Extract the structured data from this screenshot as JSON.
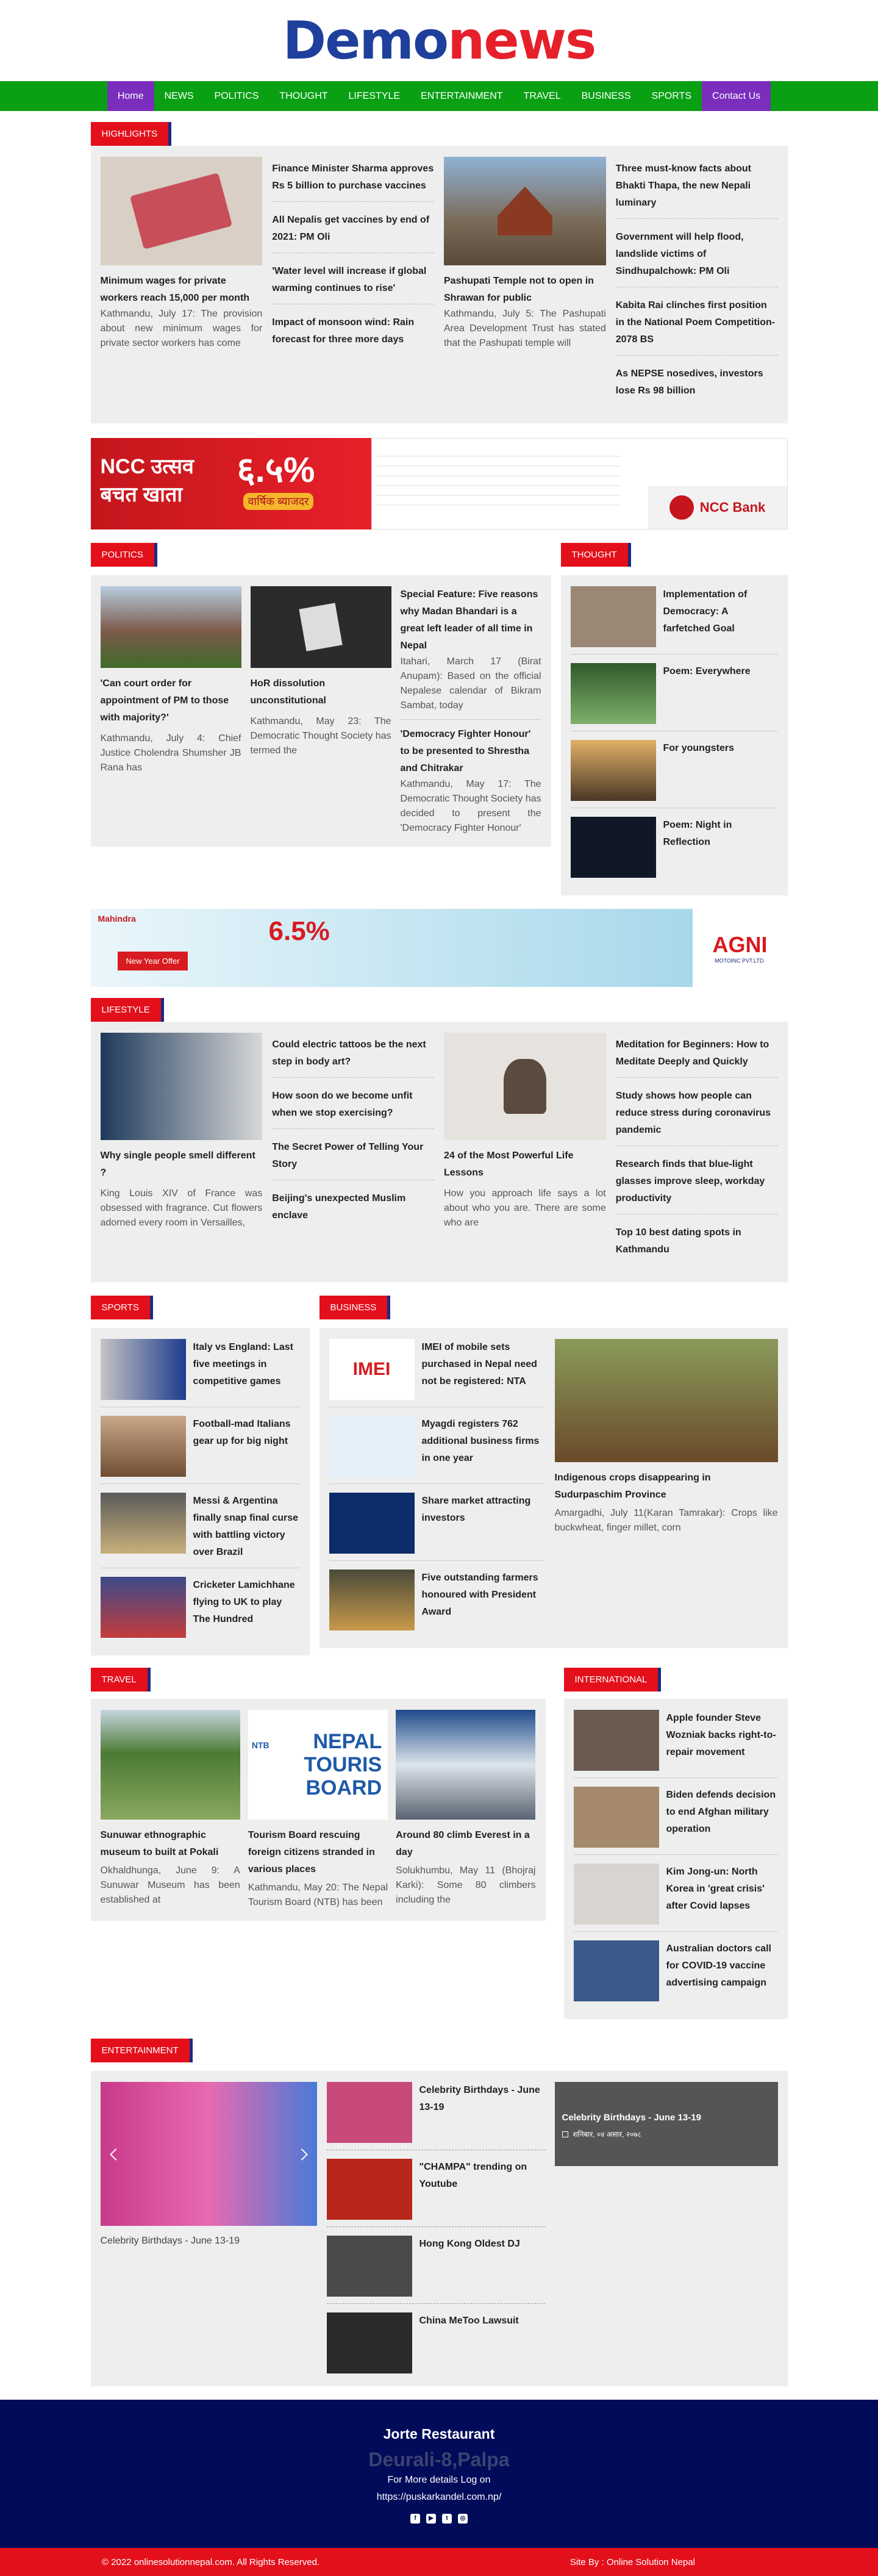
{
  "logo": {
    "a": "Demo",
    "b": "news"
  },
  "nav": [
    "Home",
    "NEWS",
    "POLITICS",
    "THOUGHT",
    "LIFESTYLE",
    "ENTERTAINMENT",
    "TRAVEL",
    "BUSINESS",
    "SPORTS",
    "Contact Us"
  ],
  "highlights": {
    "label": "HIGHLIGHTS",
    "main1": {
      "title": "Minimum wages for private workers reach 15,000 per month",
      "desc": "Kathmandu, July 17: The provision about new minimum wages for private sector workers has come"
    },
    "list1": [
      "Finance Minister Sharma approves Rs 5 billion to purchase vaccines",
      "All Nepalis get vaccines by end of 2021: PM Oli",
      "'Water level will increase if global warming continues to rise'",
      "Impact of monsoon wind: Rain forecast for three more days"
    ],
    "main2": {
      "title": "Pashupati Temple not to open in Shrawan for public",
      "desc": "Kathmandu, July 5: The Pashupati Area Development Trust has stated that the Pashupati temple will"
    },
    "list2": [
      "Three must-know facts about Bhakti Thapa, the new Nepali luminary",
      "Government will help flood, landslide victims of Sindhupalchowk: PM Oli",
      "Kabita Rai clinches first position in the National Poem Competition-2078 BS",
      "As NEPSE nosedives, investors lose Rs 98 billion"
    ]
  },
  "ad1": {
    "t1": "NCC उत्सव",
    "t2": "बचत खाता",
    "rate": "६.५%",
    "sub": "वार्षिक ब्याजदर",
    "bank": "NCC Bank"
  },
  "politics": {
    "label": "POLITICS",
    "a": {
      "title": "'Can court order for appointment of PM to those with majority?'",
      "desc": "Kathmandu, July 4: Chief Justice Cholendra Shumsher JB Rana has"
    },
    "b": {
      "title": "HoR dissolution unconstitutional",
      "desc": "Kathmandu, May 23: The Democratic Thought Society has termed the"
    },
    "c": {
      "title": "Special Feature: Five reasons why Madan Bhandari is a great left leader of all time in Nepal",
      "desc": "Itahari, March 17 (Birat Anupam): Based on the official Nepalese calendar of Bikram Sambat, today"
    },
    "d": {
      "title": "'Democracy Fighter Honour' to be presented to Shrestha and Chitrakar",
      "desc": "Kathmandu, May 17: The Democratic Thought Society has decided to present the 'Democracy Fighter Honour'"
    }
  },
  "thought": {
    "label": "THOUGHT",
    "items": [
      "Implementation of Democracy: A farfetched Goal",
      "Poem: Everywhere",
      "For youngsters",
      "Poem: Night in Reflection"
    ]
  },
  "ad2": {
    "brand": "Mahindra",
    "pct": "6.5%",
    "offer": "New Year Offer",
    "agni": "AGNI",
    "agnisub": "MOTOINC PVT.LTD."
  },
  "lifestyle": {
    "label": "LIFESTYLE",
    "main1": {
      "title": "Why single people smell different ?",
      "desc": "King Louis XIV of France was obsessed with fragrance. Cut flowers adorned every room in Versailles,"
    },
    "list1": [
      "Could electric tattoos be the next step in body art?",
      "How soon do we become unfit when we stop exercising?",
      "The Secret Power of Telling Your Story",
      "Beijing's unexpected Muslim enclave"
    ],
    "main2": {
      "title": "24 of the Most Powerful Life Lessons",
      "desc": "How you approach life says a lot about who you are. There are some who are"
    },
    "list2": [
      "Meditation for Beginners: How to Meditate Deeply and Quickly",
      "Study shows how people can reduce stress during coronavirus pandemic",
      "Research finds that blue-light glasses improve sleep, workday productivity",
      "Top 10 best dating spots in Kathmandu"
    ]
  },
  "sports": {
    "label": "SPORTS",
    "items": [
      "Italy vs England: Last five meetings in competitive games",
      "Football-mad Italians gear up for big night",
      "Messi & Argentina finally snap final curse with battling victory over Brazil",
      "Cricketer Lamichhane flying to UK to play The Hundred"
    ]
  },
  "business": {
    "label": "BUSINESS",
    "items": [
      "IMEI of mobile sets purchased in Nepal need not be registered: NTA",
      "Myagdi registers 762 additional business firms in one year",
      "Share market attracting investors",
      "Five outstanding farmers honoured with President Award"
    ],
    "main": {
      "title": "Indigenous crops disappearing in Sudurpaschim Province",
      "desc": "Amargadhi, July 11(Karan Tamrakar): Crops like buckwheat, finger millet, corn"
    }
  },
  "travel": {
    "label": "TRAVEL",
    "a": {
      "title": "Sunuwar ethnographic museum to built at Pokali",
      "desc": "Okhaldhunga, June 9: A Sunuwar Museum has been established at"
    },
    "b": {
      "title": "Tourism Board rescuing foreign citizens stranded in various places",
      "desc": "Kathmandu, May 20: The Nepal Tourism Board (NTB) has been",
      "logo1": "NEPAL",
      "logo2": "TOURIS",
      "logo3": "BOARD",
      "ntb": "NTB"
    },
    "c": {
      "title": "Around 80 climb Everest in a day",
      "desc": "Solukhumbu, May 11 (Bhojraj Karki): Some 80 climbers including the"
    }
  },
  "international": {
    "label": "INTERNATIONAL",
    "items": [
      "Apple founder Steve Wozniak backs right-to-repair movement",
      "Biden defends decision to end Afghan military operation",
      "Kim Jong-un: North Korea in 'great crisis' after Covid lapses",
      "Australian doctors call for COVID-19 vaccine advertising campaign"
    ]
  },
  "entertainment": {
    "label": "ENTERTAINMENT",
    "main": "Celebrity Birthdays - June 13-19",
    "items": [
      "Celebrity Birthdays - June 13-19",
      "\"CHAMPA\" trending on Youtube",
      "Hong Kong Oldest DJ",
      "China MeToo Lawsuit"
    ],
    "card": {
      "title": "Celebrity Birthdays - June 13-19",
      "date": "शनिबार, ०४ असार, २०७८"
    }
  },
  "footer": {
    "title": "Jorte Restaurant",
    "addr": "Deurali-8,Palpa",
    "info1": "For More details Log on",
    "info2": "https://puskarkandel.com.np/"
  },
  "bottom": {
    "left": "© 2022 onlinesolutionnepal.com. All Rights Reserved.",
    "right": "Site By : Online Solution Nepal"
  }
}
